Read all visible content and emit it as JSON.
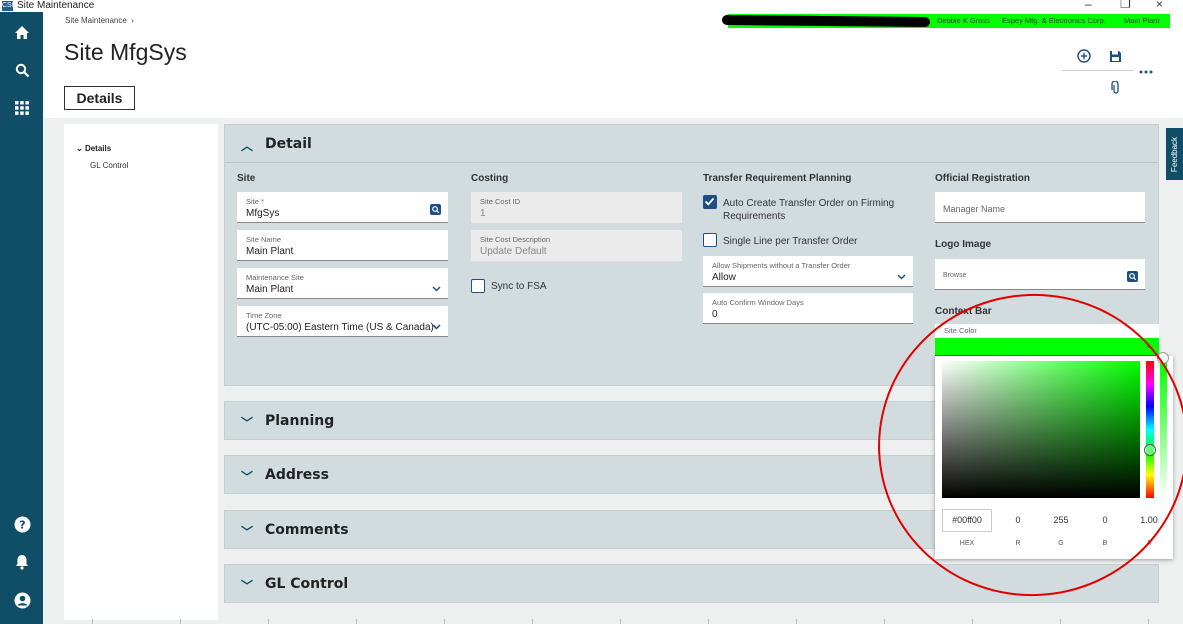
{
  "window": {
    "title": "Site Maintenance",
    "app_icon": "CSI",
    "minimize": "–",
    "restore": "❐",
    "close": "×"
  },
  "context_bar": {
    "user": "Debbie K Gross",
    "company": "Espey Mfg. & Electronics Corp.",
    "site": "Main Plant",
    "color": "#00ff00"
  },
  "breadcrumb": {
    "item": "Site Maintenance",
    "separator": "›"
  },
  "page": {
    "title": "Site MfgSys",
    "tab": "Details"
  },
  "nav_tree": {
    "parent": "Details",
    "child": "GL Control"
  },
  "feedback": "Feedback",
  "detail": {
    "title": "Detail",
    "site_col": {
      "heading": "Site",
      "site_label": "Site *",
      "site_value": "MfgSys",
      "site_name_label": "Site Name",
      "site_name_value": "Main Plant",
      "maint_site_label": "Maintenance Site",
      "maint_site_value": "Main Plant",
      "tz_label": "Time Zone",
      "tz_value": "(UTC-05:00) Eastern Time (US & Canada)"
    },
    "costing_col": {
      "heading": "Costing",
      "cost_id_label": "Site Cost ID",
      "cost_id_value": "1",
      "cost_desc_label": "Site Cost Description",
      "cost_desc_value": "Update Default",
      "sync_label": "Sync to FSA"
    },
    "transfer_col": {
      "heading": "Transfer Requirement Planning",
      "auto_create_label": "Auto Create Transfer Order on Firming Requirements",
      "single_line_label": "Single Line per Transfer Order",
      "allow_ship_label": "Allow Shipments without a Transfer Order",
      "allow_ship_value": "Allow",
      "auto_confirm_label": "Auto Confirm Window Days",
      "auto_confirm_value": "0"
    },
    "official_col": {
      "heading": "Official Registration",
      "manager_placeholder": "Manager Name",
      "logo_heading": "Logo Image",
      "browse_placeholder": "Browse",
      "context_heading": "Context Bar",
      "site_color_label": "Site Color"
    }
  },
  "sections": [
    {
      "title": "Planning"
    },
    {
      "title": "Address"
    },
    {
      "title": "Comments"
    },
    {
      "title": "GL Control"
    }
  ],
  "color_picker": {
    "hex": "#00ff00",
    "r": "0",
    "g": "255",
    "b": "0",
    "a": "1.00",
    "labels": {
      "hex": "HEX",
      "r": "R",
      "g": "G",
      "b": "B",
      "a": "A"
    },
    "selected_color": "#00ff00"
  }
}
